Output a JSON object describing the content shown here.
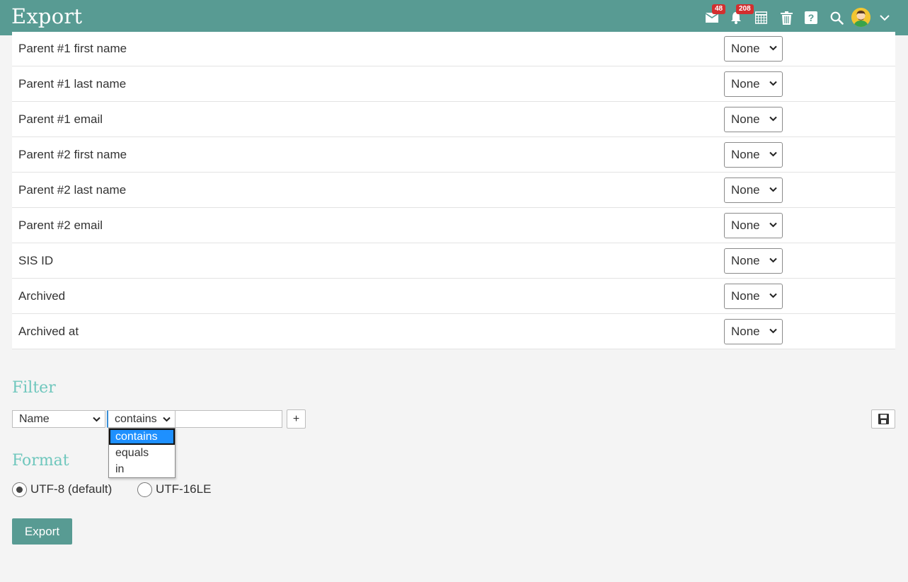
{
  "header": {
    "title": "Export",
    "messages_badge": "48",
    "notifications_badge": "208"
  },
  "fields": [
    {
      "label": "Parent #1 first name",
      "value": "None"
    },
    {
      "label": "Parent #1 last name",
      "value": "None"
    },
    {
      "label": "Parent #1 email",
      "value": "None"
    },
    {
      "label": "Parent #2 first name",
      "value": "None"
    },
    {
      "label": "Parent #2 last name",
      "value": "None"
    },
    {
      "label": "Parent #2 email",
      "value": "None"
    },
    {
      "label": "SIS ID",
      "value": "None"
    },
    {
      "label": "Archived",
      "value": "None"
    },
    {
      "label": "Archived at",
      "value": "None"
    }
  ],
  "filter": {
    "heading": "Filter",
    "field_value": "Name",
    "operator_value": "contains",
    "text_value": "",
    "add_label": "+",
    "operator_options": [
      "contains",
      "equals",
      "in"
    ],
    "selected_option_index": 0
  },
  "format": {
    "heading": "Format",
    "options": [
      {
        "label": "UTF-8 (default)",
        "checked": true
      },
      {
        "label": "UTF-16LE",
        "checked": false
      }
    ]
  },
  "export_button": "Export",
  "colors": {
    "header": "#589b93",
    "section_heading": "#6fc7bd",
    "badge": "#d32f2f",
    "dropdown_highlight": "#1e90ff"
  },
  "icons": [
    "mail-icon",
    "bell-icon",
    "calendar-icon",
    "trash-icon",
    "help-icon",
    "search-icon",
    "avatar",
    "chevron-down-icon",
    "save-icon"
  ]
}
